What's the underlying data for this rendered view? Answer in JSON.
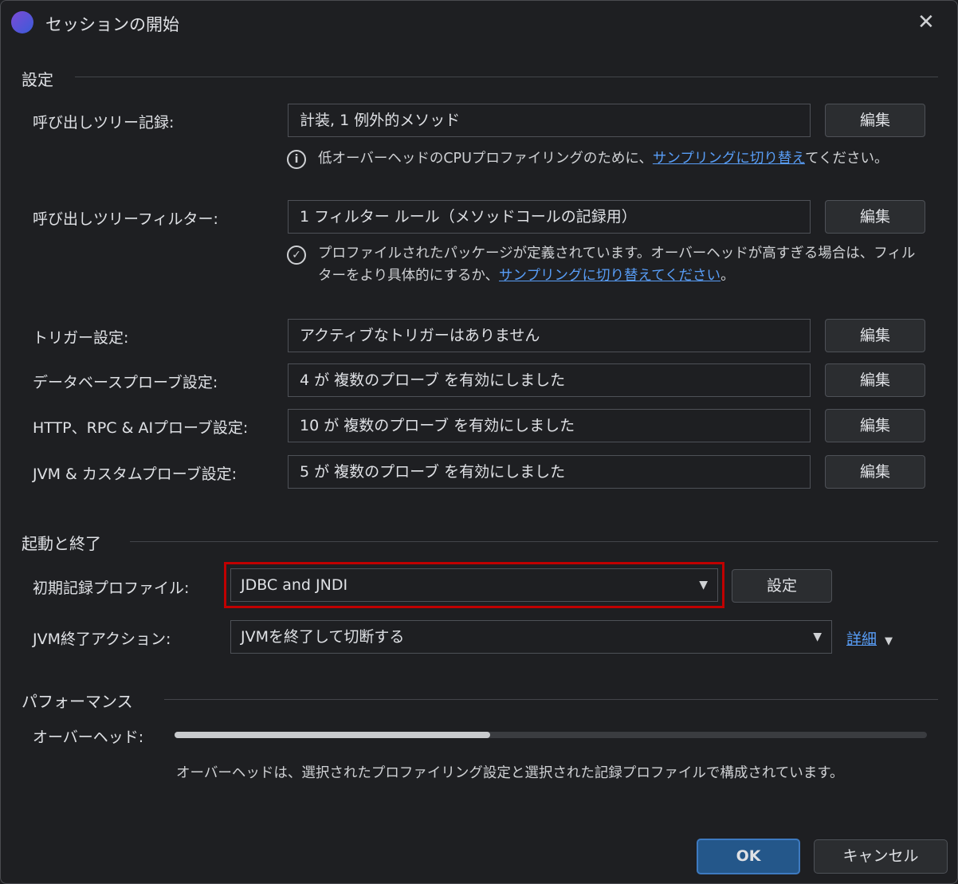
{
  "window": {
    "title": "セッションの開始",
    "close": "✕"
  },
  "settings": {
    "heading": "設定",
    "rows": [
      {
        "label": "呼び出しツリー記録:",
        "value": "計装, 1 例外的メソッド",
        "button": "編集"
      },
      {
        "label": "呼び出しツリーフィルター:",
        "value": "1 フィルター ルール（メソッドコールの記録用）",
        "button": "編集"
      },
      {
        "label": "トリガー設定:",
        "value": "アクティブなトリガーはありません",
        "button": "編集"
      },
      {
        "label": "データベースプローブ設定:",
        "value": "4 が 複数のプローブ を有効にしました",
        "button": "編集"
      },
      {
        "label": "HTTP、RPC & AIプローブ設定:",
        "value": "10 が 複数のプローブ を有効にしました",
        "button": "編集"
      },
      {
        "label": "JVM & カスタムプローブ設定:",
        "value": "5 が 複数のプローブ を有効にしました",
        "button": "編集"
      }
    ],
    "note1": {
      "text": "低オーバーヘッドのCPUプロファイリングのために、",
      "link": "サンプリングに切り替え",
      "after": "てください。"
    },
    "note2": {
      "text": "プロファイルされたパッケージが定義されています。オーバーヘッドが高すぎる場合は、フィルターをより具体的にするか、",
      "link": "サンプリングに切り替えてください",
      "after": "。"
    }
  },
  "startup": {
    "heading": "起動と終了",
    "profile_label": "初期記録プロファイル:",
    "profile_value": "JDBC and JNDI",
    "profile_button": "設定",
    "exit_label": "JVM終了アクション:",
    "exit_value": "JVMを終了して切断する",
    "details": "詳細"
  },
  "performance": {
    "heading": "パフォーマンス",
    "overhead_label": "オーバーヘッド:",
    "overhead_fraction": 0.42,
    "description": "オーバーヘッドは、選択されたプロファイリング設定と選択された記録プロファイルで構成されています。"
  },
  "footer": {
    "ok": "OK",
    "cancel": "キャンセル"
  },
  "colors": {
    "accent": "#589df6",
    "highlight": "#c00000",
    "ok": "#24578a"
  }
}
